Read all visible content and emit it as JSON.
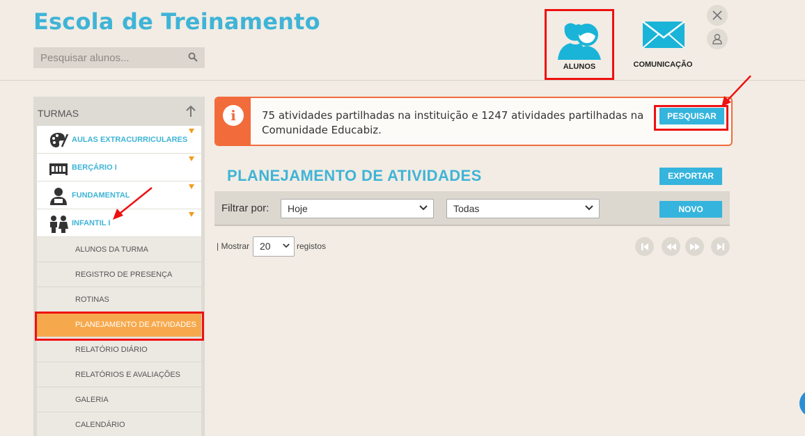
{
  "app": {
    "title": "Escola de Treinamento"
  },
  "search": {
    "placeholder": "Pesquisar alunos..."
  },
  "nav": {
    "alunos": "ALUNOS",
    "comunicacao": "COMUNICAÇÃO"
  },
  "sidebar": {
    "title": "TURMAS",
    "groups": [
      {
        "label": "AULAS EXTRACURRICULARES",
        "icon": "palette-icon"
      },
      {
        "label": "BERÇÁRIO I",
        "icon": "crib-icon"
      },
      {
        "label": "FUNDAMENTAL",
        "icon": "student-icon"
      },
      {
        "label": "INFANTIL I",
        "icon": "children-icon"
      }
    ],
    "subitems": [
      "ALUNOS DA TURMA",
      "REGISTRO DE PRESENÇA",
      "ROTINAS",
      "PLANEJAMENTO DE ATIVIDADES",
      "RELATÓRIO DIÁRIO",
      "RELATÓRIOS E AVALIAÇÕES",
      "GALERIA",
      "CALENDÁRIO"
    ],
    "active_subitem": "PLANEJAMENTO DE ATIVIDADES"
  },
  "notice": {
    "text": "75 atividades partilhadas na instituição e 1247 atividades partilhadas na Comunidade Educabiz.",
    "button": "PESQUISAR"
  },
  "main": {
    "title": "PLANEJAMENTO DE ATIVIDADES",
    "export_button": "EXPORTAR",
    "new_button": "NOVO",
    "filter_label": "Filtrar por:",
    "filter_date": "Hoje",
    "filter_type": "Todas",
    "show_label": "| Mostrar",
    "page_size": "20",
    "records_label": "registos"
  },
  "colors": {
    "accent": "#3fb4d6",
    "button": "#35b4dd",
    "notice": "#f26b3a",
    "active": "#f6a94c",
    "highlight": "#ee1111",
    "background": "#f2ece4"
  }
}
